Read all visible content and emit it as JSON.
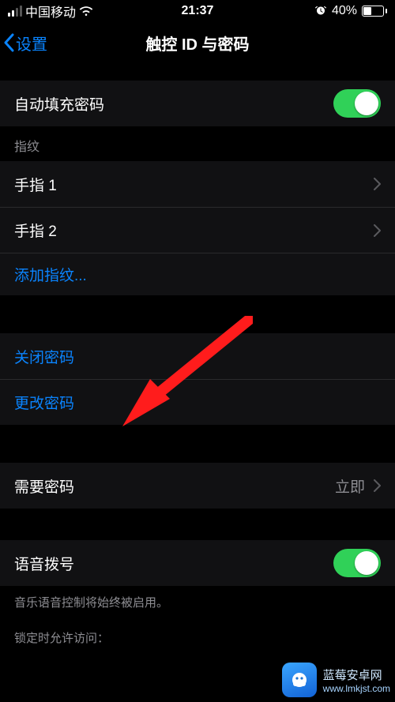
{
  "status": {
    "carrier": "中国移动",
    "time": "21:37",
    "battery_pct": "40%"
  },
  "nav": {
    "back_label": "设置",
    "title": "触控 ID 与密码"
  },
  "rows": {
    "autofill": "自动填充密码",
    "fingerprint_header": "指纹",
    "finger1": "手指 1",
    "finger2": "手指 2",
    "add_finger": "添加指纹...",
    "turn_off": "关闭密码",
    "change_pwd": "更改密码",
    "require_pwd": "需要密码",
    "require_pwd_value": "立即",
    "voice_dial": "语音拨号",
    "voice_note": "音乐语音控制将始终被启用。",
    "lock_access": "锁定时允许访问："
  },
  "watermark": {
    "title": "蓝莓安卓网",
    "url": "www.lmkjst.com"
  }
}
